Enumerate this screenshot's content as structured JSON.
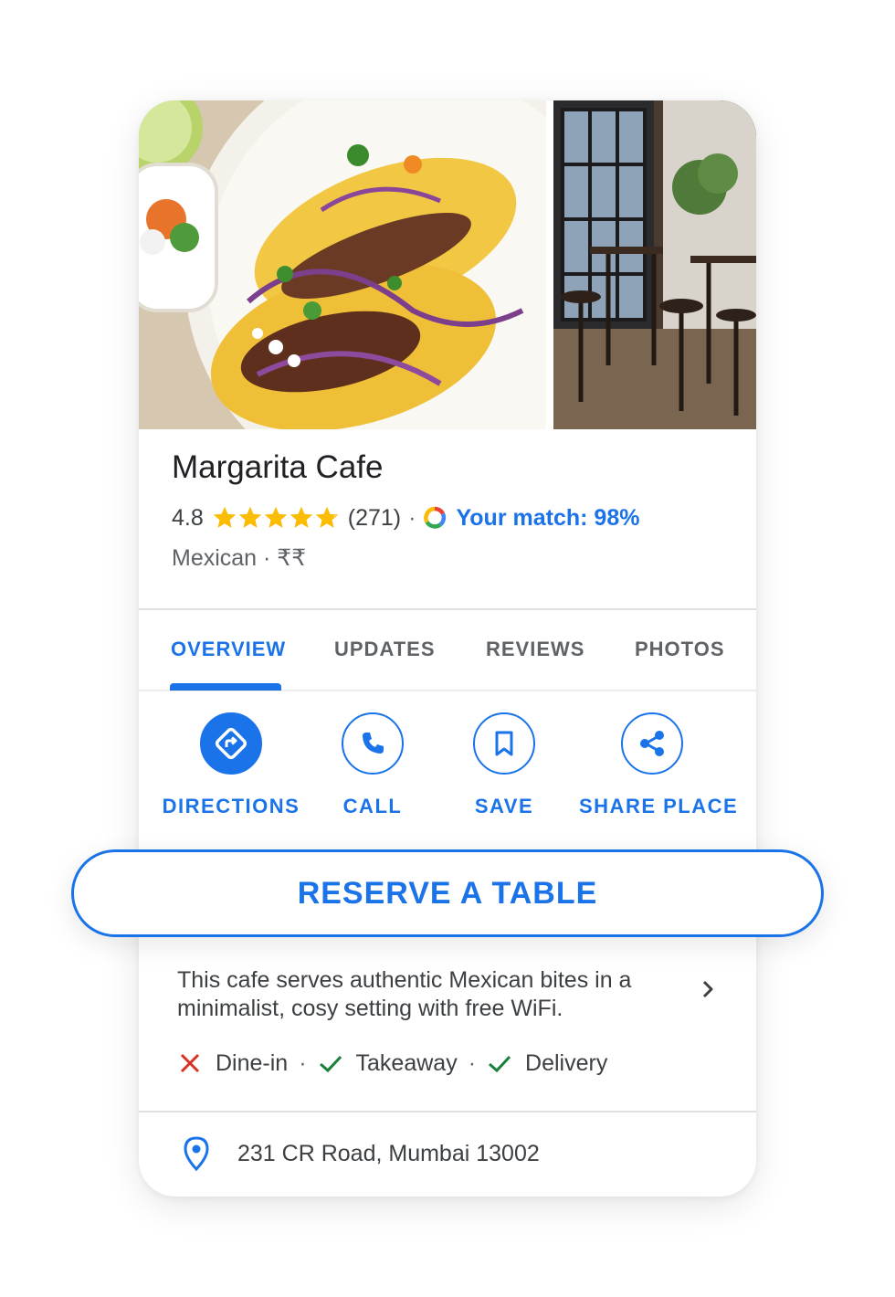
{
  "place": {
    "name": "Margarita Cafe",
    "rating": "4.8",
    "stars_value": 4.8,
    "stars_max": 5,
    "review_count": "(271)",
    "separator": "·",
    "match": "Your match: 98%",
    "cuisine": "Mexican",
    "price": "₹₹",
    "meta": "Mexican · ₹₹"
  },
  "photos": [
    {
      "name": "food-photo",
      "subject": "tacos on a plate"
    },
    {
      "name": "interior-photo",
      "subject": "cafe interior"
    }
  ],
  "tabs": [
    {
      "label": "OVERVIEW",
      "active": true
    },
    {
      "label": "UPDATES",
      "active": false
    },
    {
      "label": "REVIEWS",
      "active": false
    },
    {
      "label": "PHOTOS",
      "active": false
    }
  ],
  "actions": [
    {
      "label": "DIRECTIONS",
      "icon": "directions-icon",
      "filled": true
    },
    {
      "label": "CALL",
      "icon": "phone-icon",
      "filled": false
    },
    {
      "label": "SAVE",
      "icon": "bookmark-icon",
      "filled": false
    },
    {
      "label": "SHARE PLACE",
      "icon": "share-icon",
      "filled": false
    }
  ],
  "reserve_label": "RESERVE A TABLE",
  "description": "This cafe serves authentic Mexican bites in a minimalist, cosy setting with free WiFi.",
  "services": [
    {
      "label": "Dine-in",
      "available": false
    },
    {
      "label": "Takeaway",
      "available": true
    },
    {
      "label": "Delivery",
      "available": true
    }
  ],
  "address": "231 CR Road, Mumbai 13002",
  "colors": {
    "accent": "#1a73e8",
    "star": "#fbbc04",
    "unavailable": "#d93025",
    "available": "#188038",
    "text": "#202124",
    "secondary_text": "#5f6368"
  }
}
